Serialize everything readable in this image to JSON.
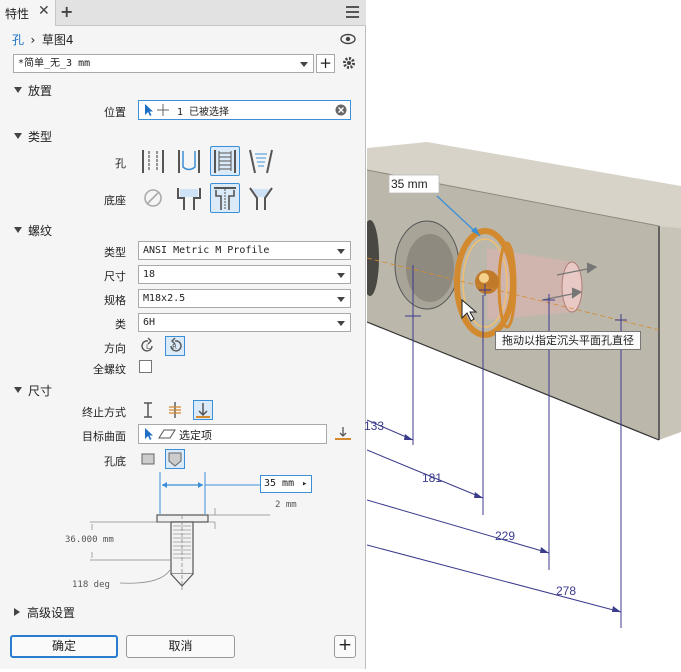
{
  "panel": {
    "tab_label": "特性",
    "close_glyph": "✕",
    "add_glyph": "+",
    "breadcrumb": {
      "feature": "孔",
      "sketch": "草图4"
    },
    "preset": {
      "value": "*简单_无_3 mm"
    },
    "placement": {
      "title": "放置",
      "position_label": "位置",
      "position_value": "1 已被选择"
    },
    "type": {
      "title": "类型",
      "hole_label": "孔",
      "seat_label": "底座",
      "hole_options": [
        "simple-hole-icon",
        "clearance-hole-icon",
        "tapped-hole-icon",
        "taper-tapped-hole-icon"
      ],
      "seat_options": [
        "no-seat-icon",
        "counterbore-icon",
        "spotface-icon",
        "countersink-icon"
      ]
    },
    "thread": {
      "title": "螺纹",
      "type_label": "类型",
      "type_value": "ANSI Metric M Profile",
      "size_label": "尺寸",
      "size_value": "18",
      "designation_label": "规格",
      "designation_value": "M18x2.5",
      "class_label": "类",
      "class_value": "6H",
      "direction_label": "方向",
      "full_depth_label": "全螺纹",
      "full_depth_checked": false
    },
    "size": {
      "title": "尺寸",
      "termination_label": "终止方式",
      "target_label": "目标曲面",
      "target_value": "选定项",
      "bottom_label": "孔底",
      "preview": {
        "diameter": "35 mm",
        "depth": "36.000 mm",
        "head_depth": "2 mm",
        "drill_angle": "118 deg"
      }
    },
    "advanced": {
      "title": "高级设置"
    },
    "buttons": {
      "ok": "确定",
      "cancel": "取消",
      "plus": "+"
    }
  },
  "viewport": {
    "diameter_label": "35 mm",
    "tooltip": "拖动以指定沉头平面孔直径",
    "dimensions": [
      "133",
      "181",
      "229",
      "278"
    ]
  },
  "colors": {
    "accent": "#2a7ccf",
    "dimension": "#3b3b8c",
    "block_front": "#bcb7ab",
    "block_top": "#d8d3c8",
    "hole_ring": "#d38a2e"
  }
}
